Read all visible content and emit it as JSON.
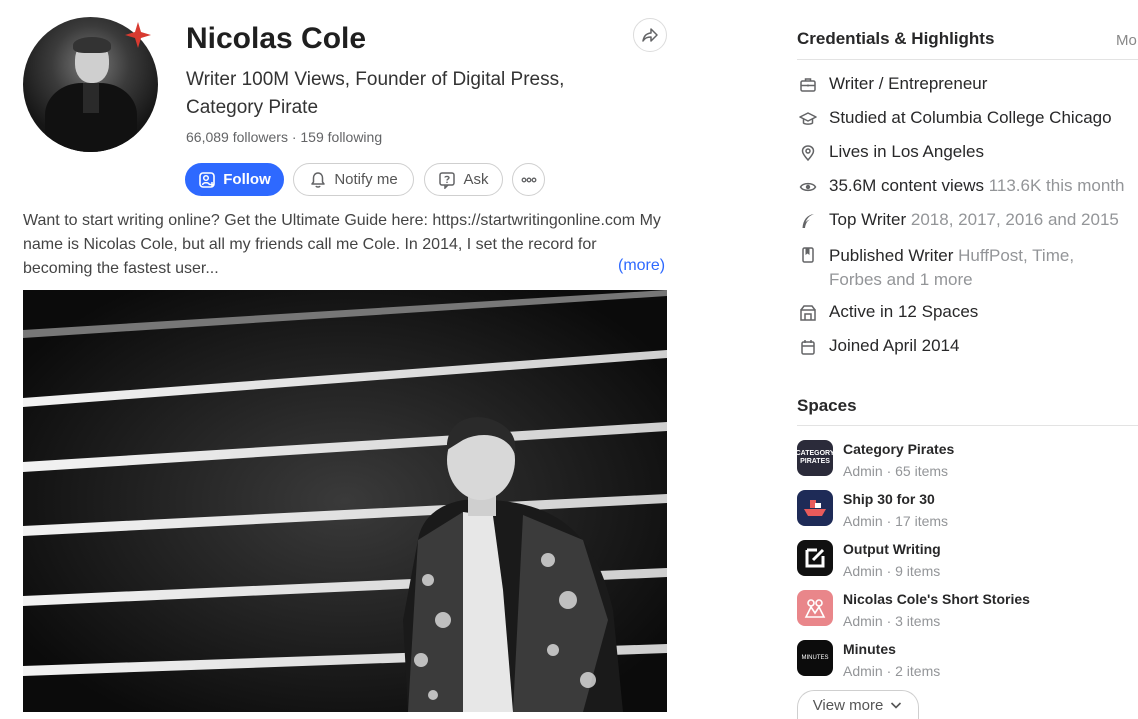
{
  "profile": {
    "name": "Nicolas Cole",
    "tagline": "Writer 100M Views, Founder of Digital Press, Category Pirate",
    "counts": "66,089 followers · 159 following",
    "bio": "Want to start writing online? Get the Ultimate Guide here: https://startwritingonline.com My name is Nicolas Cole, but all my friends call me Cole. In 2014, I set the record for becoming the fastest user...",
    "more_link": "(more)"
  },
  "actions": {
    "follow": "Follow",
    "notify": "Notify me",
    "ask": "Ask"
  },
  "credentials": {
    "title": "Credentials & Highlights",
    "more": "Mo",
    "items": [
      {
        "icon": "briefcase-icon",
        "main": "Writer / Entrepreneur",
        "muted": ""
      },
      {
        "icon": "graduation-cap-icon",
        "main": "Studied at Columbia College Chicago",
        "muted": ""
      },
      {
        "icon": "location-pin-icon",
        "main": "Lives in Los Angeles",
        "muted": ""
      },
      {
        "icon": "eye-icon",
        "main": "35.6M content views",
        "muted": "113.6K this month"
      },
      {
        "icon": "quill-icon",
        "main": "Top Writer",
        "muted": "2018, 2017, 2016 and 2015"
      },
      {
        "icon": "book-icon",
        "main": "Published Writer",
        "muted": "HuffPost, Time, Forbes and 1 more"
      },
      {
        "icon": "spaces-icon",
        "main": "Active in 12 Spaces",
        "muted": ""
      },
      {
        "icon": "calendar-icon",
        "main": "Joined April 2014",
        "muted": ""
      }
    ]
  },
  "spaces": {
    "title": "Spaces",
    "items": [
      {
        "name": "Category Pirates",
        "meta": "Admin · 65 items",
        "logo_text": "CATEGORY PIRATES",
        "color": "#2b2b3a"
      },
      {
        "name": "Ship 30 for 30",
        "meta": "Admin · 17 items",
        "logo_text": "",
        "color": "#1e2b57"
      },
      {
        "name": "Output Writing",
        "meta": "Admin · 9 items",
        "logo_text": "",
        "color": "#111111"
      },
      {
        "name": "Nicolas Cole's Short Stories",
        "meta": "Admin · 3 items",
        "logo_text": "",
        "color": "#e9868a"
      },
      {
        "name": "Minutes",
        "meta": "Admin · 2 items",
        "logo_text": "MINUTES",
        "color": "#0c0c0c"
      }
    ],
    "view_more": "View more"
  },
  "colors": {
    "accent": "#2e69ff",
    "star": "#d83a30"
  }
}
